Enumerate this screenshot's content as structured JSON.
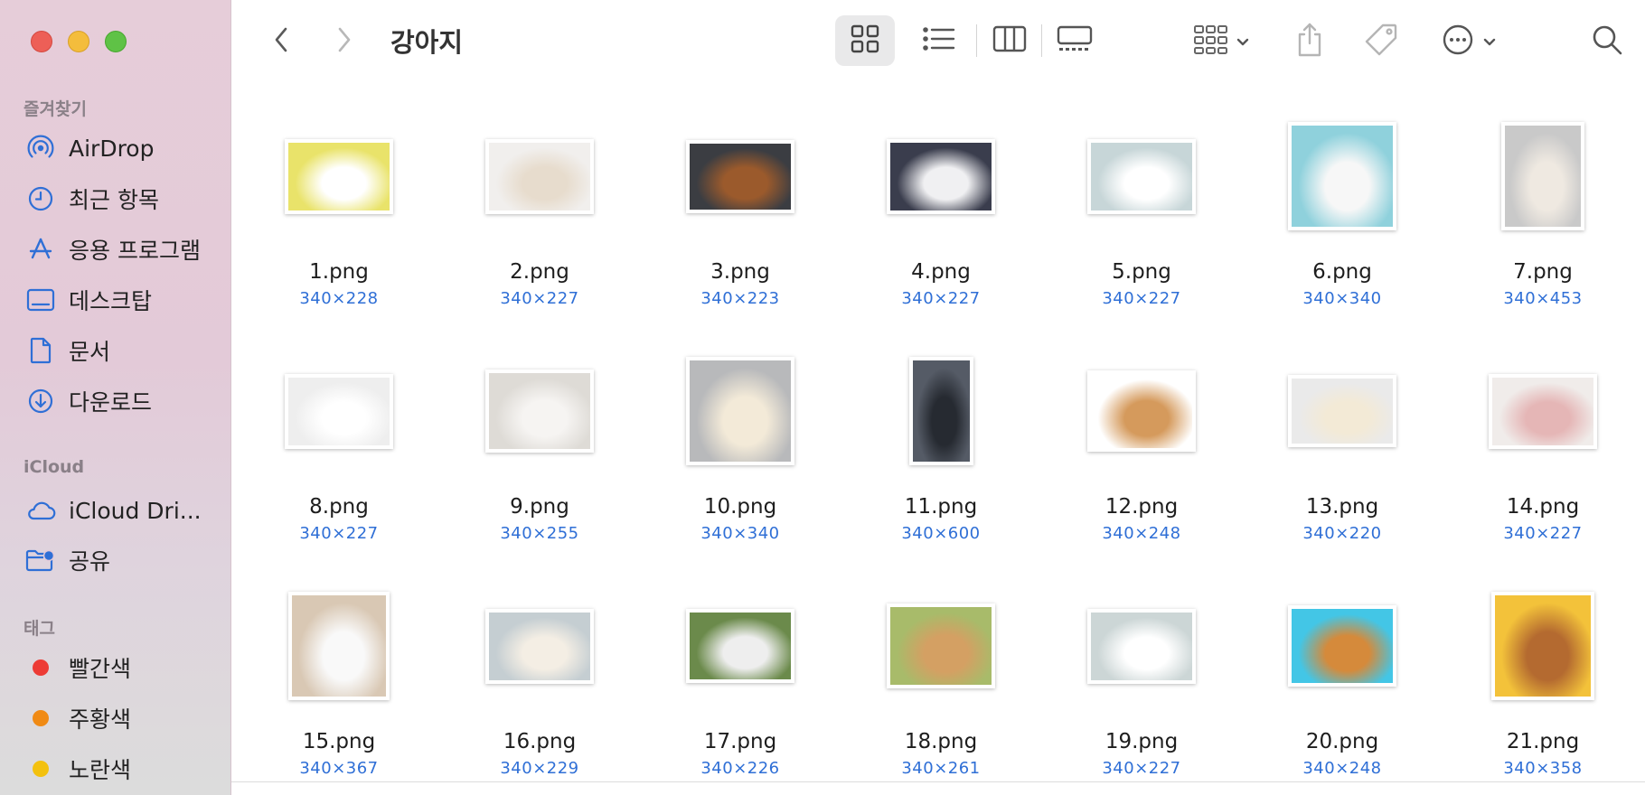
{
  "window": {
    "title": "강아지"
  },
  "sidebar": {
    "favorites_title": "즐겨찾기",
    "favorites": [
      {
        "label": "AirDrop",
        "icon": "airdrop-icon"
      },
      {
        "label": "최근 항목",
        "icon": "clock-icon"
      },
      {
        "label": "응용 프로그램",
        "icon": "applications-icon"
      },
      {
        "label": "데스크탑",
        "icon": "desktop-icon"
      },
      {
        "label": "문서",
        "icon": "document-icon"
      },
      {
        "label": "다운로드",
        "icon": "download-icon"
      }
    ],
    "icloud_title": "iCloud",
    "icloud": [
      {
        "label": "iCloud Dri...",
        "icon": "cloud-icon"
      },
      {
        "label": "공유",
        "icon": "shared-folder-icon"
      }
    ],
    "tags_title": "태그",
    "tags": [
      {
        "label": "빨간색",
        "color": "#ed3b35"
      },
      {
        "label": "주황색",
        "color": "#f08a14"
      },
      {
        "label": "노란색",
        "color": "#f3c10e"
      }
    ]
  },
  "toolbar": {
    "back": "chevron-left-icon",
    "forward": "chevron-right-icon",
    "views": [
      "icon-view-icon",
      "list-view-icon",
      "column-view-icon",
      "gallery-view-icon"
    ],
    "active_view": "icon-view-icon",
    "group": "group-icon",
    "share": "share-icon",
    "tag": "tag-icon",
    "more": "ellipsis-circle-icon",
    "search": "search-icon"
  },
  "files": [
    {
      "name": "1.png",
      "dims": "340×228",
      "colors": [
        "#e9e36a",
        "#ffffff"
      ]
    },
    {
      "name": "2.png",
      "dims": "340×227",
      "colors": [
        "#f1efed",
        "#e7dccd"
      ]
    },
    {
      "name": "3.png",
      "dims": "340×223",
      "colors": [
        "#3b3d42",
        "#9b5a2c"
      ]
    },
    {
      "name": "4.png",
      "dims": "340×227",
      "colors": [
        "#3a3d4d",
        "#f0f0f2"
      ]
    },
    {
      "name": "5.png",
      "dims": "340×227",
      "colors": [
        "#c7d6d8",
        "#ffffff"
      ]
    },
    {
      "name": "6.png",
      "dims": "340×340",
      "colors": [
        "#8fd1dc",
        "#f7f7f7"
      ]
    },
    {
      "name": "7.png",
      "dims": "340×453",
      "colors": [
        "#c9c9c9",
        "#efe9e1"
      ]
    },
    {
      "name": "8.png",
      "dims": "340×227",
      "colors": [
        "#eeeeee",
        "#ffffff"
      ]
    },
    {
      "name": "9.png",
      "dims": "340×255",
      "colors": [
        "#dedbd6",
        "#f6f4f2"
      ]
    },
    {
      "name": "10.png",
      "dims": "340×340",
      "colors": [
        "#b8b9bb",
        "#f3ead8"
      ]
    },
    {
      "name": "11.png",
      "dims": "340×600",
      "colors": [
        "#555b66",
        "#262a31"
      ]
    },
    {
      "name": "12.png",
      "dims": "340×248",
      "colors": [
        "#ffffff",
        "#d59a5c"
      ]
    },
    {
      "name": "13.png",
      "dims": "340×220",
      "colors": [
        "#eaeaea",
        "#f3ead6"
      ]
    },
    {
      "name": "14.png",
      "dims": "340×227",
      "colors": [
        "#f0ecea",
        "#e5b6b6"
      ]
    },
    {
      "name": "15.png",
      "dims": "340×367",
      "colors": [
        "#d9c8b4",
        "#f9f9f9"
      ]
    },
    {
      "name": "16.png",
      "dims": "340×229",
      "colors": [
        "#c5ced2",
        "#f4eee4"
      ]
    },
    {
      "name": "17.png",
      "dims": "340×226",
      "colors": [
        "#6b8a4b",
        "#eeeeee"
      ]
    },
    {
      "name": "18.png",
      "dims": "340×261",
      "colors": [
        "#a8bb6a",
        "#d4a063"
      ]
    },
    {
      "name": "19.png",
      "dims": "340×227",
      "colors": [
        "#ccd6d6",
        "#ffffff"
      ]
    },
    {
      "name": "20.png",
      "dims": "340×248",
      "colors": [
        "#43c6e6",
        "#d58a3b"
      ]
    },
    {
      "name": "21.png",
      "dims": "340×358",
      "colors": [
        "#f3c23a",
        "#b46a30"
      ]
    }
  ]
}
